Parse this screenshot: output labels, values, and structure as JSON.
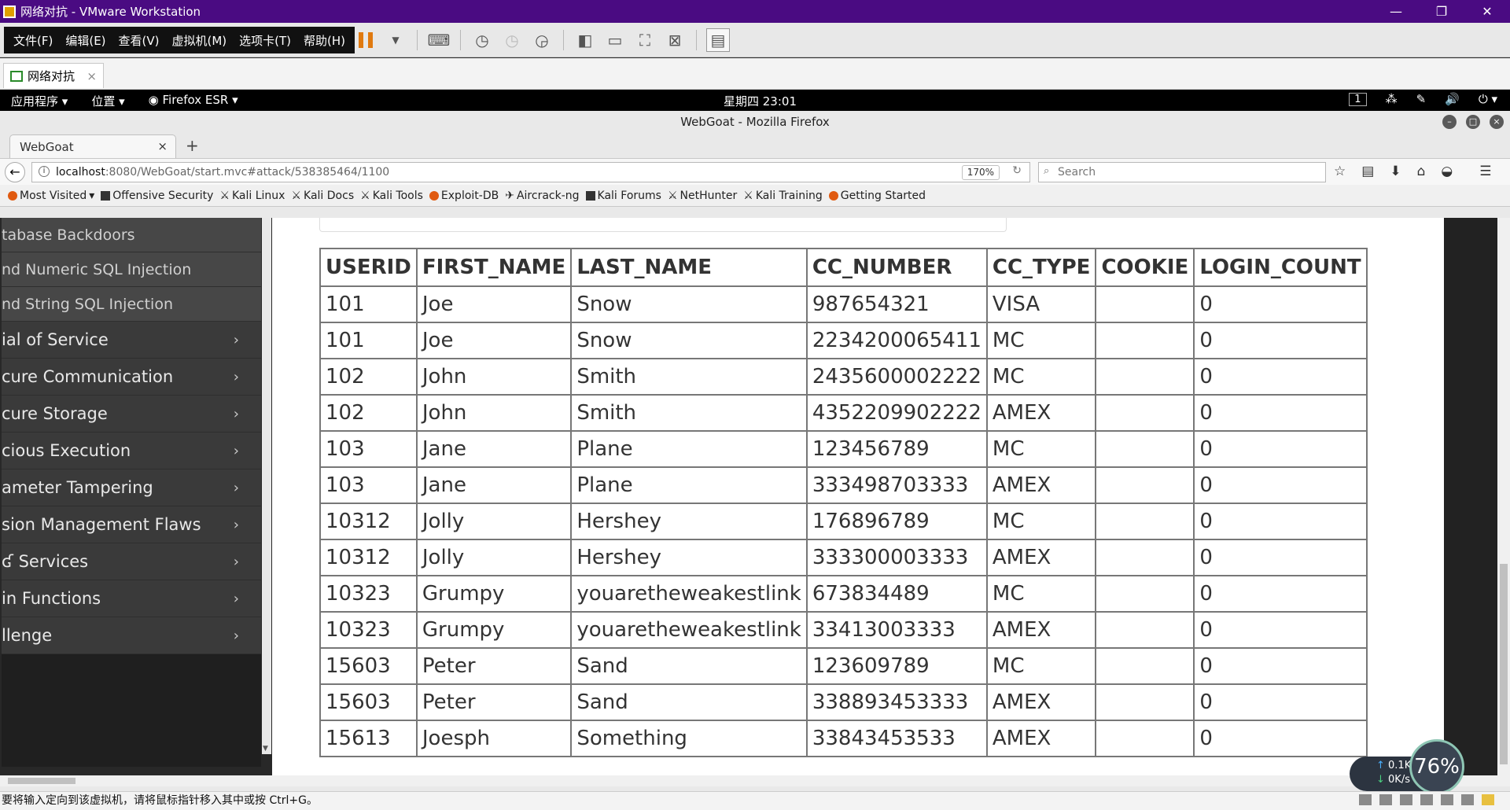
{
  "vmware": {
    "title": "网络对抗 - VMware Workstation",
    "menu": [
      "文件(F)",
      "编辑(E)",
      "查看(V)",
      "虚拟机(M)",
      "选项卡(T)",
      "帮助(H)"
    ],
    "tab_label": "网络对抗",
    "tab_close": "×",
    "status_text": "要将输入定向到该虚拟机，请将鼠标指针移入其中或按 Ctrl+G。"
  },
  "gnome": {
    "apps": "应用程序 ▾",
    "places": "位置 ▾",
    "firefox": "Firefox ESR ▾",
    "clock": "星期四 23:01",
    "workspace": "1"
  },
  "firefox": {
    "window_title": "WebGoat - Mozilla Firefox",
    "tab_title": "WebGoat",
    "url_host": "localhost",
    "url_rest": ":8080/WebGoat/start.mvc#attack/538385464/1100",
    "zoom": "170%",
    "search_placeholder": "Search",
    "bookmarks": [
      "Most Visited",
      "Offensive Security",
      "Kali Linux",
      "Kali Docs",
      "Kali Tools",
      "Exploit-DB",
      "Aircrack-ng",
      "Kali Forums",
      "NetHunter",
      "Kali Training",
      "Getting Started"
    ]
  },
  "sidebar": {
    "sub_items": [
      "tabase Backdoors",
      "nd Numeric SQL Injection",
      "nd String SQL Injection"
    ],
    "items": [
      "ial of Service",
      "cure Communication",
      "cure Storage",
      "cious Execution",
      "ameter Tampering",
      "sion Management Flaws",
      "Services",
      "in Functions",
      "llenge"
    ]
  },
  "table": {
    "headers": [
      "USERID",
      "FIRST_NAME",
      "LAST_NAME",
      "CC_NUMBER",
      "CC_TYPE",
      "COOKIE",
      "LOGIN_COUNT"
    ],
    "rows": [
      [
        "101",
        "Joe",
        "Snow",
        "987654321",
        "VISA",
        "",
        "0"
      ],
      [
        "101",
        "Joe",
        "Snow",
        "2234200065411",
        "MC",
        "",
        "0"
      ],
      [
        "102",
        "John",
        "Smith",
        "2435600002222",
        "MC",
        "",
        "0"
      ],
      [
        "102",
        "John",
        "Smith",
        "4352209902222",
        "AMEX",
        "",
        "0"
      ],
      [
        "103",
        "Jane",
        "Plane",
        "123456789",
        "MC",
        "",
        "0"
      ],
      [
        "103",
        "Jane",
        "Plane",
        "333498703333",
        "AMEX",
        "",
        "0"
      ],
      [
        "10312",
        "Jolly",
        "Hershey",
        "176896789",
        "MC",
        "",
        "0"
      ],
      [
        "10312",
        "Jolly",
        "Hershey",
        "333300003333",
        "AMEX",
        "",
        "0"
      ],
      [
        "10323",
        "Grumpy",
        "youaretheweakestlink",
        "673834489",
        "MC",
        "",
        "0"
      ],
      [
        "10323",
        "Grumpy",
        "youaretheweakestlink",
        "33413003333",
        "AMEX",
        "",
        "0"
      ],
      [
        "15603",
        "Peter",
        "Sand",
        "123609789",
        "MC",
        "",
        "0"
      ],
      [
        "15603",
        "Peter",
        "Sand",
        "338893453333",
        "AMEX",
        "",
        "0"
      ],
      [
        "15613",
        "Joesph",
        "Something",
        "33843453533",
        "AMEX",
        "",
        "0"
      ]
    ]
  },
  "network": {
    "up": "0.1K/s",
    "down": "0K/s",
    "percent": "76%"
  }
}
